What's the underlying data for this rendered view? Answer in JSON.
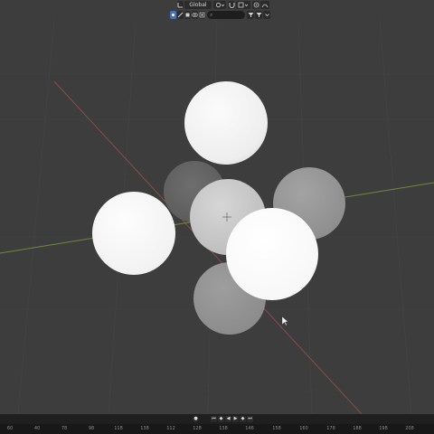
{
  "header": {
    "transform_orientation": "Global",
    "pivot_label": "",
    "snap_label": "",
    "search_placeholder": ""
  },
  "viewport": {
    "background": "#3d3d3d",
    "grid_color": "#454545",
    "x_axis_color": "#8c4a50",
    "y_axis_color": "#6e8a3c"
  },
  "timeline": {
    "controls": [
      "start",
      "prev-key",
      "play-reverse",
      "play",
      "next-key",
      "end"
    ],
    "ruler_ticks": [
      "60",
      "40",
      "78",
      "98",
      "118",
      "138",
      "112",
      "128",
      "138",
      "146",
      "158",
      "160",
      "178",
      "188",
      "198",
      "208"
    ]
  }
}
